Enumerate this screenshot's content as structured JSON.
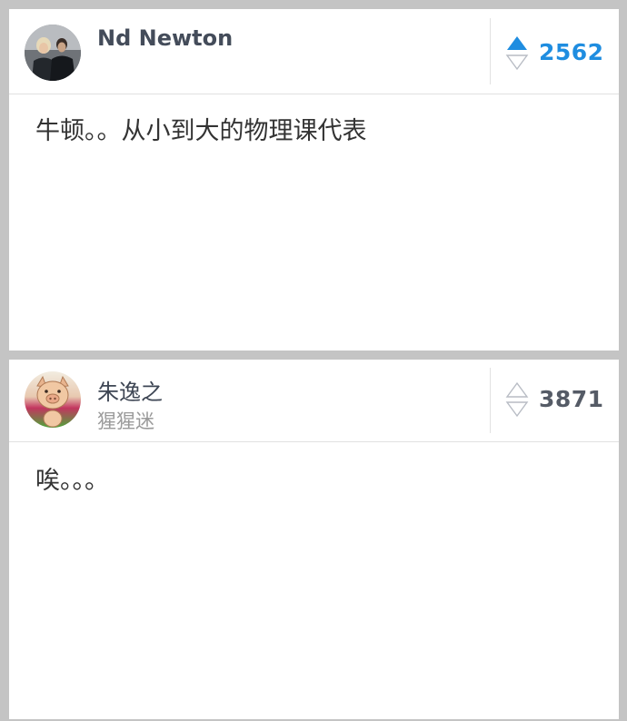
{
  "answers": [
    {
      "author": {
        "name": "Nd Newton",
        "bio": ""
      },
      "votes": {
        "count": "2562",
        "upvoted": true,
        "active_color": "#1f8de0"
      },
      "content": "牛顿。。从小到大的物理课代表"
    },
    {
      "author": {
        "name": "朱逸之",
        "bio": "猩猩迷"
      },
      "votes": {
        "count": "3871",
        "upvoted": false,
        "inactive_color": "#b8bcc4"
      },
      "content": "唉。。。"
    }
  ]
}
